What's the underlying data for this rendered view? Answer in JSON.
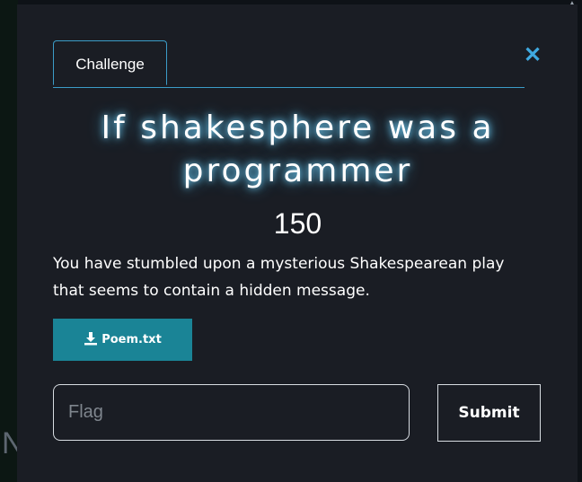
{
  "background": {
    "partial_letter": "N"
  },
  "modal": {
    "tab_label": "Challenge",
    "close_icon": "close-icon",
    "challenge_title": "If shakesphere was a programmer",
    "points": "150",
    "description": "You have stumbled upon a mysterious Shakespearean play that seems to contain a hidden message.",
    "download": {
      "label": "Poem.txt",
      "icon": "download-icon"
    },
    "flag_input": {
      "value": "",
      "placeholder": "Flag"
    },
    "submit_label": "Submit"
  },
  "colors": {
    "accent": "#3b9cc8",
    "close_icon": "#3fa9e0",
    "download_button": "#1a8496",
    "modal_background": "#1a1d24"
  }
}
